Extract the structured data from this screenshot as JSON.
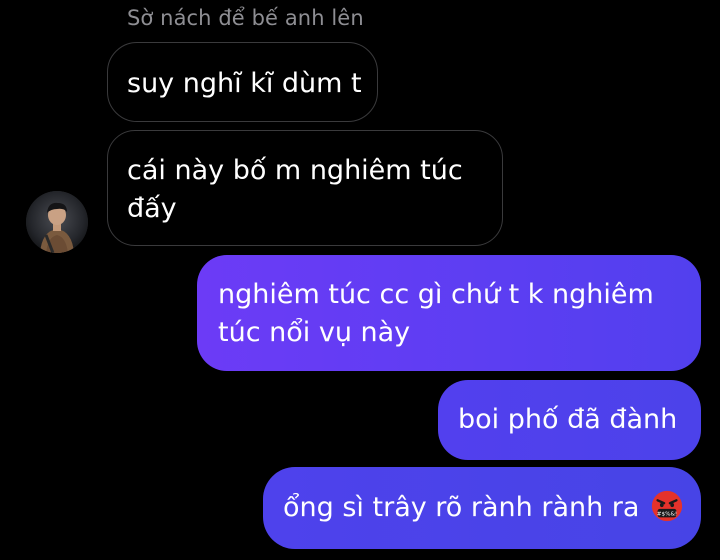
{
  "reply": {
    "header": "Sờ nách để bế anh lên"
  },
  "messages": [
    {
      "side": "incoming",
      "text": "suy nghĩ kĩ dùm t"
    },
    {
      "side": "incoming",
      "text": "cái này bố m nghiêm túc đấy"
    },
    {
      "side": "outgoing",
      "text": "nghiêm túc cc gì chứ t k nghiêm túc nổi vụ này"
    },
    {
      "side": "outgoing",
      "text": "boi phố đã đành"
    },
    {
      "side": "outgoing",
      "text": "ổng sì trây rõ rành rành ra",
      "emoji": "angry-face-with-symbols-icon"
    }
  ],
  "avatar": {
    "icon": "user-avatar-photo"
  },
  "colors": {
    "background": "#000000",
    "incoming_border": "#3a3a3c",
    "outgoing_start": "#6c3bf6",
    "outgoing_end": "#4744e6",
    "reply_header": "#8e8e93",
    "emoji_face": "#e5322b"
  }
}
